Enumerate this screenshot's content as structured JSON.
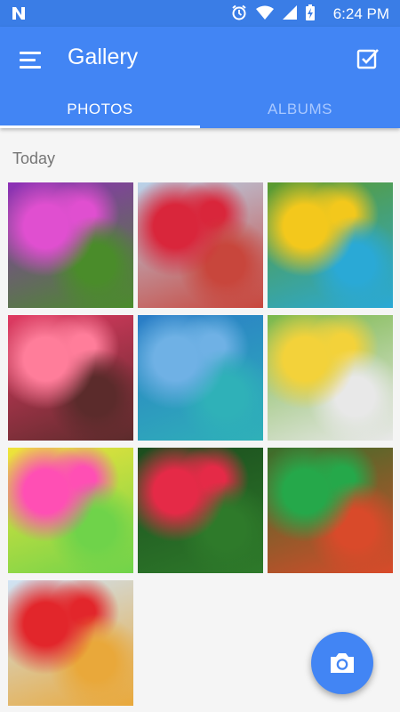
{
  "status_bar": {
    "time": "6:24 PM",
    "icons": [
      "n-logo-icon",
      "alarm-icon",
      "wifi-icon",
      "signal-icon",
      "battery-charging-icon"
    ]
  },
  "app_bar": {
    "title": "Gallery",
    "menu_icon": "menu-icon",
    "select_icon": "checkbox-icon"
  },
  "tabs": [
    {
      "label": "PHOTOS",
      "active": true
    },
    {
      "label": "ALBUMS",
      "active": false
    }
  ],
  "section": {
    "title": "Today"
  },
  "photos": [
    {
      "name": "purple-petunias",
      "colors": [
        "#8e2fb8",
        "#e04fd0",
        "#4a8c2a"
      ]
    },
    {
      "name": "red-heart-tree",
      "colors": [
        "#b9d3ea",
        "#d9263b",
        "#c8463c"
      ]
    },
    {
      "name": "lovebirds",
      "colors": [
        "#5c9a2c",
        "#f3c81c",
        "#2aa9d6"
      ]
    },
    {
      "name": "pink-tree",
      "colors": [
        "#e03a62",
        "#ff7d9a",
        "#5b2b2b"
      ]
    },
    {
      "name": "burj-al-arab",
      "colors": [
        "#2a7cc7",
        "#6fb1e5",
        "#2fb1b8"
      ]
    },
    {
      "name": "girl-umbrella",
      "colors": [
        "#7ab84a",
        "#f3d23a",
        "#e8e8e8"
      ]
    },
    {
      "name": "colorful-chicks",
      "colors": [
        "#f1e33a",
        "#ff4fb4",
        "#6fd34a"
      ]
    },
    {
      "name": "red-rose",
      "colors": [
        "#1b4d1e",
        "#e52a47",
        "#2e7a2a"
      ]
    },
    {
      "name": "baby-elf",
      "colors": [
        "#3a6e2a",
        "#25a84a",
        "#d94a2a"
      ]
    },
    {
      "name": "red-sports-car",
      "colors": [
        "#cfe3f5",
        "#e2262b",
        "#e9a83a"
      ]
    }
  ],
  "fab": {
    "icon": "camera-icon"
  },
  "colors": {
    "primary": "#4285f4",
    "status_bar": "#3a7de6",
    "background": "#f5f5f5"
  }
}
